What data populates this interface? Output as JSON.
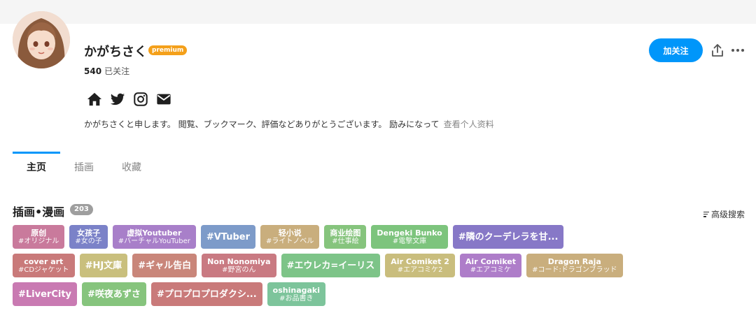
{
  "profile": {
    "username": "かがちさく",
    "premium_badge": "premium",
    "following_count": "540",
    "following_label": "已关注",
    "bio": "かがちさくと申します。 閲覧、ブックマーク、評価などありがとうございます。 励みになって",
    "view_profile": "查看个人资料",
    "social_icons": [
      "home-icon",
      "twitter-icon",
      "instagram-icon",
      "mail-icon"
    ]
  },
  "actions": {
    "follow_label": "加关注",
    "share_icon": "share-icon",
    "more_icon": "more-icon"
  },
  "tabs": [
    {
      "label": "主页",
      "active": true
    },
    {
      "label": "插画",
      "active": false
    },
    {
      "label": "收藏",
      "active": false
    }
  ],
  "section": {
    "title": "插画•漫画",
    "count": "203",
    "advanced_search": "高级搜索"
  },
  "tags": [
    [
      {
        "name": "原创",
        "translation": "#オリジナル",
        "color": "#c97a9c"
      },
      {
        "name": "女孩子",
        "translation": "#女の子",
        "color": "#7b82c8"
      },
      {
        "name": "虚拟Youtuber",
        "translation": "#バーチャルYouTuber",
        "color": "#a87fc9"
      },
      {
        "name": "#VTuber",
        "translation": "",
        "color": "#7d9bc9"
      },
      {
        "name": "轻小说",
        "translation": "#ライトノベル",
        "color": "#c9ae7d"
      },
      {
        "name": "商业绘图",
        "translation": "#仕事絵",
        "color": "#86c47d"
      },
      {
        "name": "Dengeki Bunko",
        "translation": "#電撃文庫",
        "color": "#7dc47d"
      },
      {
        "name": "#隣のクーデレラを甘...",
        "translation": "",
        "color": "#8778c7"
      }
    ],
    [
      {
        "name": "cover art",
        "translation": "#CDジャケット",
        "color": "#c97a7a"
      },
      {
        "name": "#HJ文庫",
        "translation": "",
        "color": "#c9bf7d"
      },
      {
        "name": "#ギャル告白",
        "translation": "",
        "color": "#c9867a"
      },
      {
        "name": "Non Nonomiya",
        "translation": "#野宮のん",
        "color": "#c97a82"
      },
      {
        "name": "#エウレカ=イーリス",
        "translation": "",
        "color": "#7dc488"
      },
      {
        "name": "Air Comiket 2",
        "translation": "#エアコミケ2",
        "color": "#c9bd7d"
      },
      {
        "name": "Air Comiket",
        "translation": "#エアコミケ",
        "color": "#ae7dc9"
      },
      {
        "name": "Dragon Raja",
        "translation": "#コード:ドラゴンブラッド",
        "color": "#c9ae7d"
      }
    ],
    [
      {
        "name": "#LiverCity",
        "translation": "",
        "color": "#c97ab2"
      },
      {
        "name": "#咲夜あずさ",
        "translation": "",
        "color": "#86c47d"
      },
      {
        "name": "#プロプロプロダクシ...",
        "translation": "",
        "color": "#c97a7a"
      },
      {
        "name": "oshinagaki",
        "translation": "#お品書き",
        "color": "#7dc49b"
      }
    ]
  ]
}
